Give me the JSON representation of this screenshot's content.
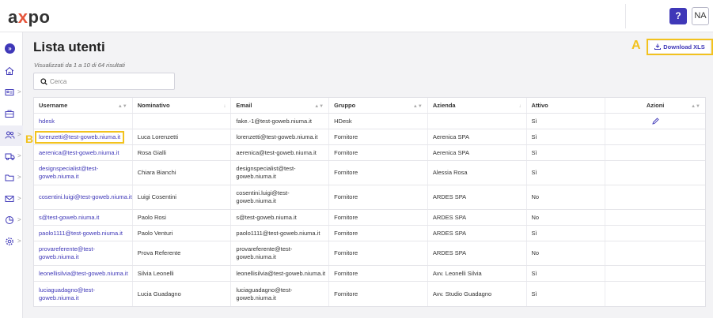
{
  "header": {
    "logo_a": "a",
    "logo_x": "x",
    "logo_po": "po",
    "help_label": "?",
    "user_initials": "NA"
  },
  "sidebar": {
    "expand_icon": "double-chevron-right-icon",
    "items": [
      {
        "icon": "home-icon",
        "has_chevron": false
      },
      {
        "icon": "id-card-icon",
        "has_chevron": true
      },
      {
        "icon": "briefcase-icon",
        "has_chevron": false
      },
      {
        "icon": "users-icon",
        "has_chevron": true
      },
      {
        "icon": "truck-icon",
        "has_chevron": true
      },
      {
        "icon": "folder-icon",
        "has_chevron": true
      },
      {
        "icon": "mail-icon",
        "has_chevron": true
      },
      {
        "icon": "chart-icon",
        "has_chevron": true
      },
      {
        "icon": "gear-icon",
        "has_chevron": true
      }
    ],
    "chevron": ">"
  },
  "page": {
    "title": "Lista utenti",
    "subtitle": "Visualizzati da 1 a 10 di 64 risultati",
    "search_placeholder": "Cerca",
    "download_label": "Download XLS",
    "marker_a": "A",
    "marker_b": "B"
  },
  "table": {
    "columns": [
      "Username",
      "Nominativo",
      "Email",
      "Gruppo",
      "Azienda",
      "Attivo",
      "Azioni"
    ],
    "rows": [
      {
        "username": "hdesk",
        "nominativo": "",
        "email": "fake.-1@test-goweb.niuma.it",
        "gruppo": "HDesk",
        "azienda": "",
        "attivo": "Sì",
        "azioni": "edit"
      },
      {
        "username": "lorenzetti@test-goweb.niuma.it",
        "nominativo": "Luca Lorenzetti",
        "email": "lorenzetti@test-goweb.niuma.it",
        "gruppo": "Fornitore",
        "azienda": "Aerenica SPA",
        "attivo": "Sì",
        "azioni": ""
      },
      {
        "username": "aerenica@test-goweb.niuma.it",
        "nominativo": "Rosa Gialli",
        "email": "aerenica@test-goweb.niuma.it",
        "gruppo": "Fornitore",
        "azienda": "Aerenica SPA",
        "attivo": "Sì",
        "azioni": ""
      },
      {
        "username": "designspecialist@test-goweb.niuma.it",
        "nominativo": "Chiara Bianchi",
        "email": "designspecialist@test-goweb.niuma.it",
        "gruppo": "Fornitore",
        "azienda": "Alessia Rosa",
        "attivo": "Sì",
        "azioni": ""
      },
      {
        "username": "cosentini.luigi@test-goweb.niuma.it",
        "nominativo": "Luigi Cosentini",
        "email": "cosentini.luigi@test-goweb.niuma.it",
        "gruppo": "Fornitore",
        "azienda": "ARDES SPA",
        "attivo": "No",
        "azioni": ""
      },
      {
        "username": "s@test-goweb.niuma.it",
        "nominativo": "Paolo Rosi",
        "email": "s@test-goweb.niuma.it",
        "gruppo": "Fornitore",
        "azienda": "ARDES SPA",
        "attivo": "No",
        "azioni": ""
      },
      {
        "username": "paolo1111@test-goweb.niuma.it",
        "nominativo": "Paolo Venturi",
        "email": "paolo1111@test-goweb.niuma.it",
        "gruppo": "Fornitore",
        "azienda": "ARDES SPA",
        "attivo": "Sì",
        "azioni": ""
      },
      {
        "username": "provareferente@test-goweb.niuma.it",
        "nominativo": "Prova Referente",
        "email": "provareferente@test-goweb.niuma.it",
        "gruppo": "Fornitore",
        "azienda": "ARDES SPA",
        "attivo": "No",
        "azioni": ""
      },
      {
        "username": "leonellisilvia@test-goweb.niuma.it",
        "nominativo": "Silvia Leonelli",
        "email": "leonellisilvia@test-goweb.niuma.it",
        "gruppo": "Fornitore",
        "azienda": "Avv. Leonelli Silvia",
        "attivo": "Sì",
        "azioni": ""
      },
      {
        "username": "luciaguadagno@test-goweb.niuma.it",
        "nominativo": "Lucia Guadagno",
        "email": "luciaguadagno@test-goweb.niuma.it",
        "gruppo": "Fornitore",
        "azienda": "Avv. Studio Guadagno",
        "attivo": "Sì",
        "azioni": ""
      }
    ]
  },
  "colors": {
    "accent": "#3f38b8",
    "highlight": "#f2c21e",
    "logo_x": "#e5553b"
  }
}
